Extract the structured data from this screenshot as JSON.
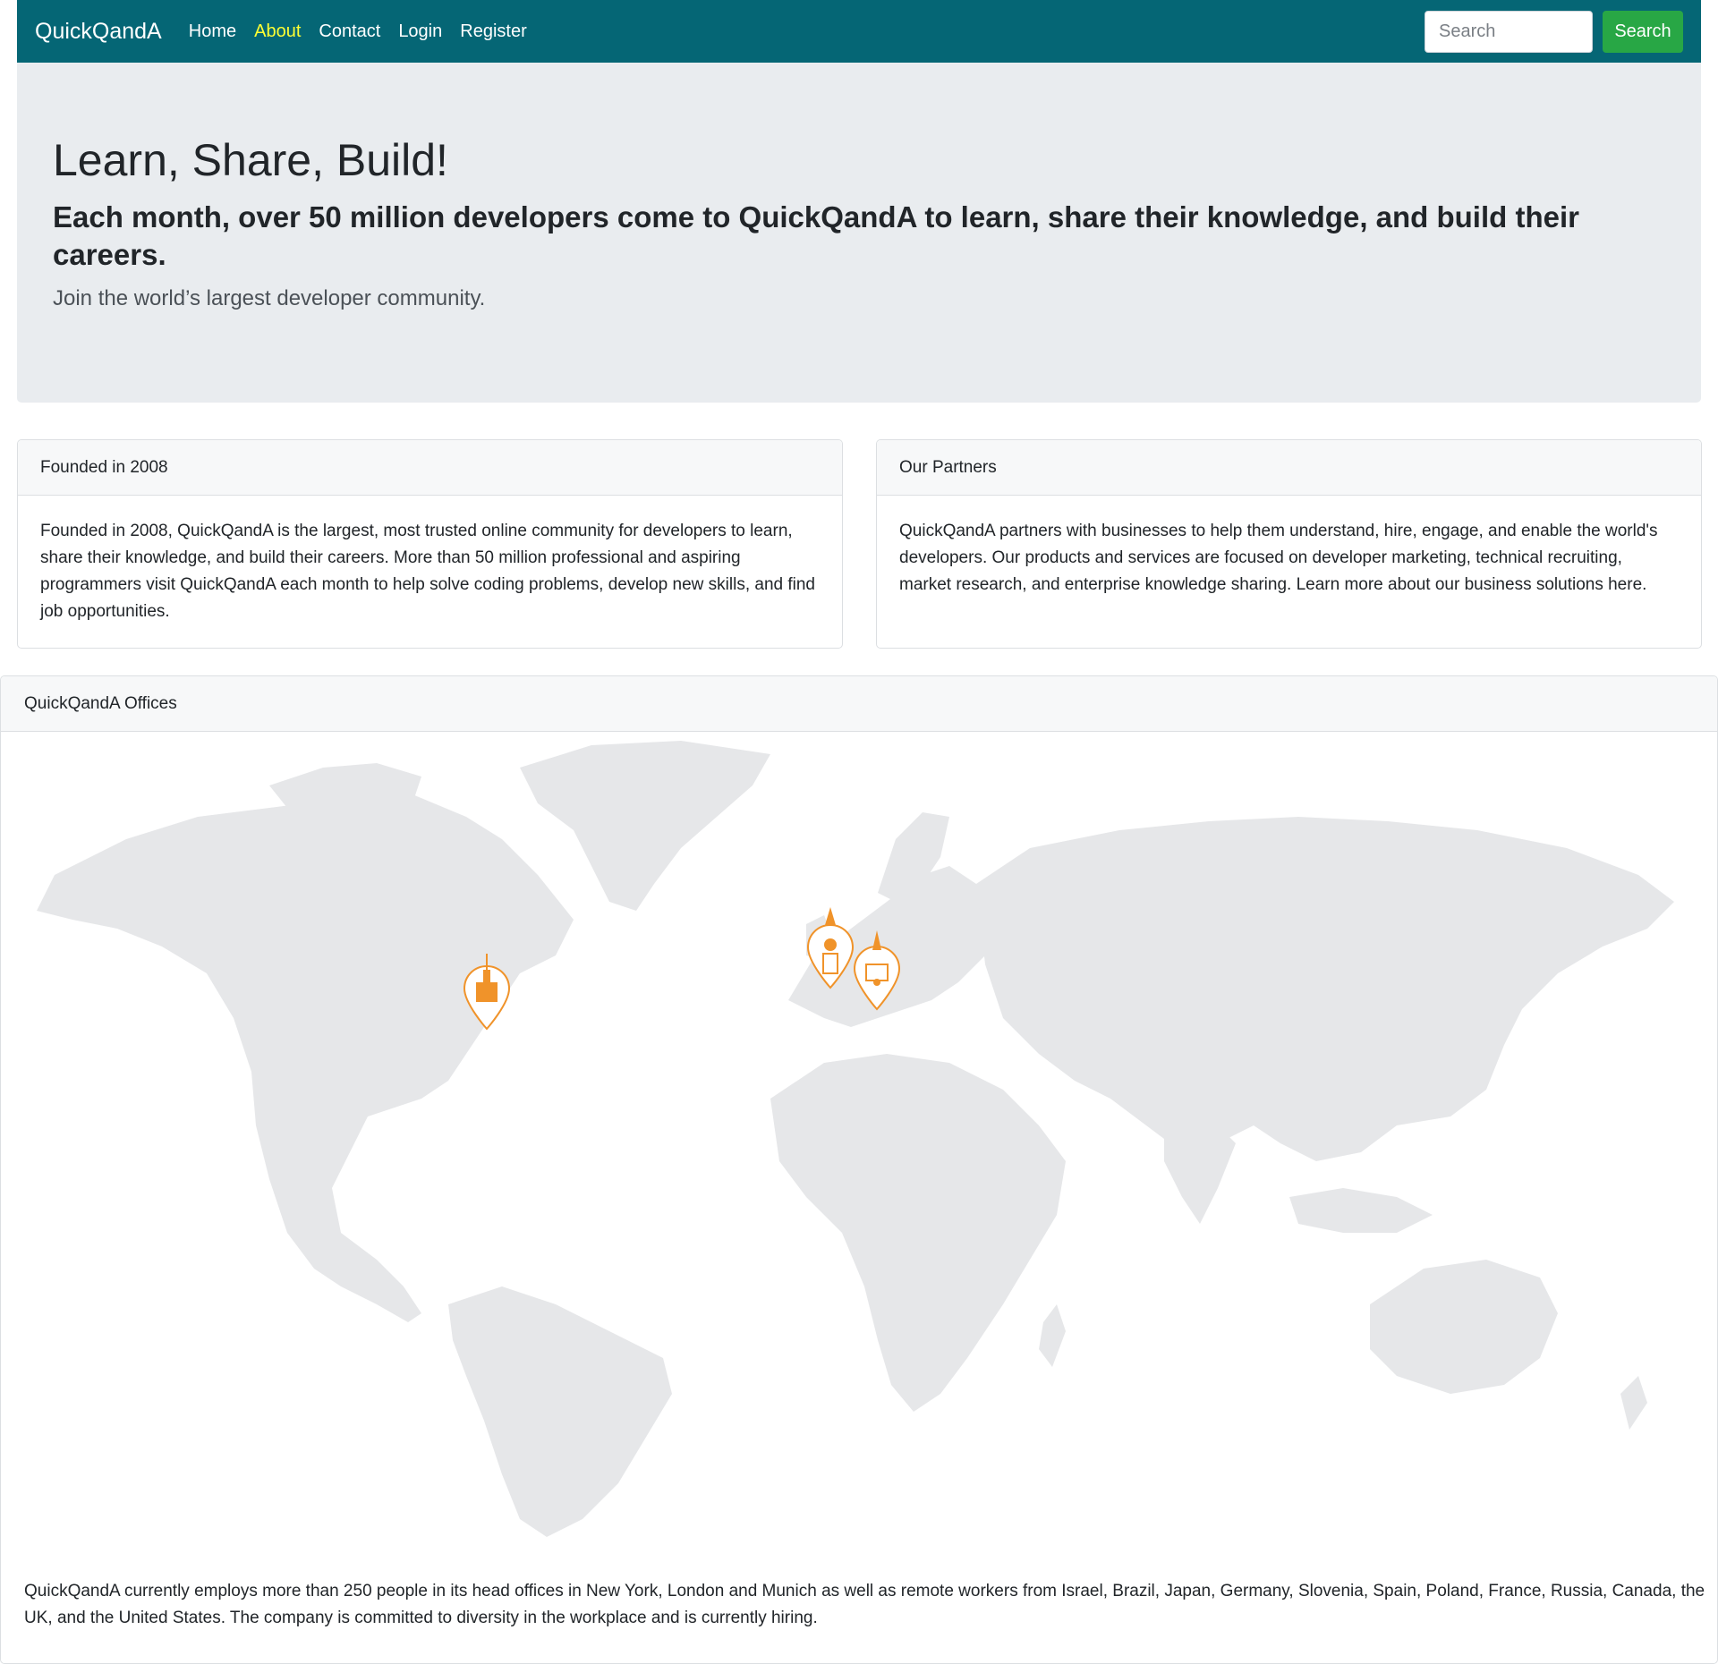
{
  "navbar": {
    "brand": "QuickQandA",
    "links": [
      {
        "label": "Home",
        "active": false
      },
      {
        "label": "About",
        "active": true
      },
      {
        "label": "Contact",
        "active": false
      },
      {
        "label": "Login",
        "active": false
      },
      {
        "label": "Register",
        "active": false
      }
    ],
    "search_placeholder": "Search",
    "search_button": "Search"
  },
  "hero": {
    "title": "Learn, Share, Build!",
    "subtitle": "Each month, over 50 million developers come to QuickQandA to learn, share their knowledge, and build their careers.",
    "lead": "Join the world’s largest developer community."
  },
  "cards": {
    "founded": {
      "header": "Founded in 2008",
      "body": "Founded in 2008, QuickQandA is the largest, most trusted online community for developers to learn, share their knowledge, and build their careers. More than 50 million professional and aspiring programmers visit QuickQandA each month to help solve coding problems, develop new skills, and find job opportunities."
    },
    "partners": {
      "header": "Our Partners",
      "body": "QuickQandA partners with businesses to help them understand, hire, engage, and enable the world's developers. Our products and services are focused on developer marketing, technical recruiting, market research, and enterprise knowledge sharing. Learn more about our business solutions here."
    },
    "offices": {
      "header": "QuickQandA Offices",
      "body": "QuickQandA currently employs more than 250 people in its head offices in New York, London and Munich as well as remote workers from Israel, Brazil, Japan, Germany, Slovenia, Spain, Poland, France, Russia, Canada, the UK, and the United States. The company is committed to diversity in the workplace and is currently hiring."
    }
  },
  "map": {
    "land_color": "#e6e7e9",
    "marker_color": "#f0932a",
    "markers": [
      "new-york-marker-icon",
      "london-marker-icon",
      "munich-marker-icon"
    ]
  },
  "colors": {
    "navbar": "#056675",
    "active_link": "#ffff33",
    "search_button": "#28a745",
    "hero_bg": "#e9ecef"
  }
}
